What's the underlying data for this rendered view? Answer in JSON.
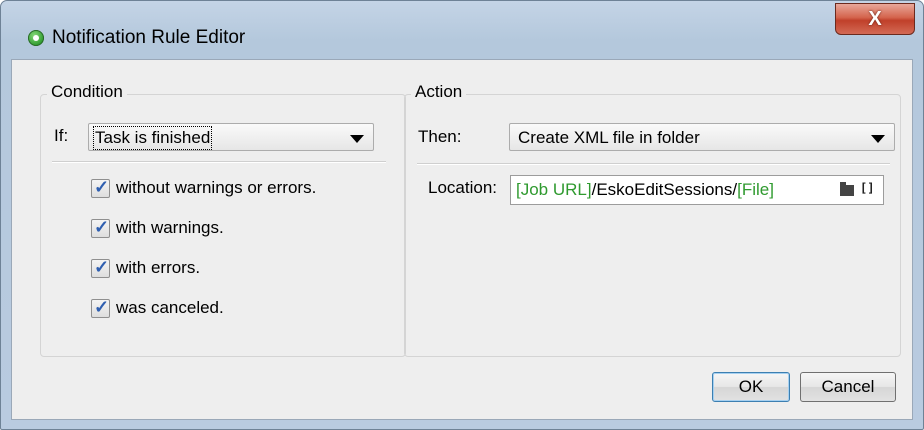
{
  "window": {
    "title": "Notification Rule Editor",
    "close_glyph": "X"
  },
  "condition": {
    "legend": "Condition",
    "if_label": "If:",
    "if_value": "Task is finished",
    "options": [
      {
        "label": "without warnings or errors.",
        "checked": true
      },
      {
        "label": "with warnings.",
        "checked": true
      },
      {
        "label": "with errors.",
        "checked": true
      },
      {
        "label": "was canceled.",
        "checked": true
      }
    ]
  },
  "action": {
    "legend": "Action",
    "then_label": "Then:",
    "then_value": "Create XML file in folder",
    "location_label": "Location:",
    "location_parts": [
      {
        "text": "[Job URL]",
        "kind": "token"
      },
      {
        "text": "/EskoEditSessions/",
        "kind": "plain"
      },
      {
        "text": "[File]",
        "kind": "token"
      }
    ],
    "icons": [
      "folder-icon",
      "brackets-icon"
    ]
  },
  "buttons": {
    "ok": "OK",
    "cancel": "Cancel"
  },
  "colors": {
    "token": "#2f9a2f",
    "checkmark": "#2f5fb0",
    "close_button": "#c0402a"
  }
}
